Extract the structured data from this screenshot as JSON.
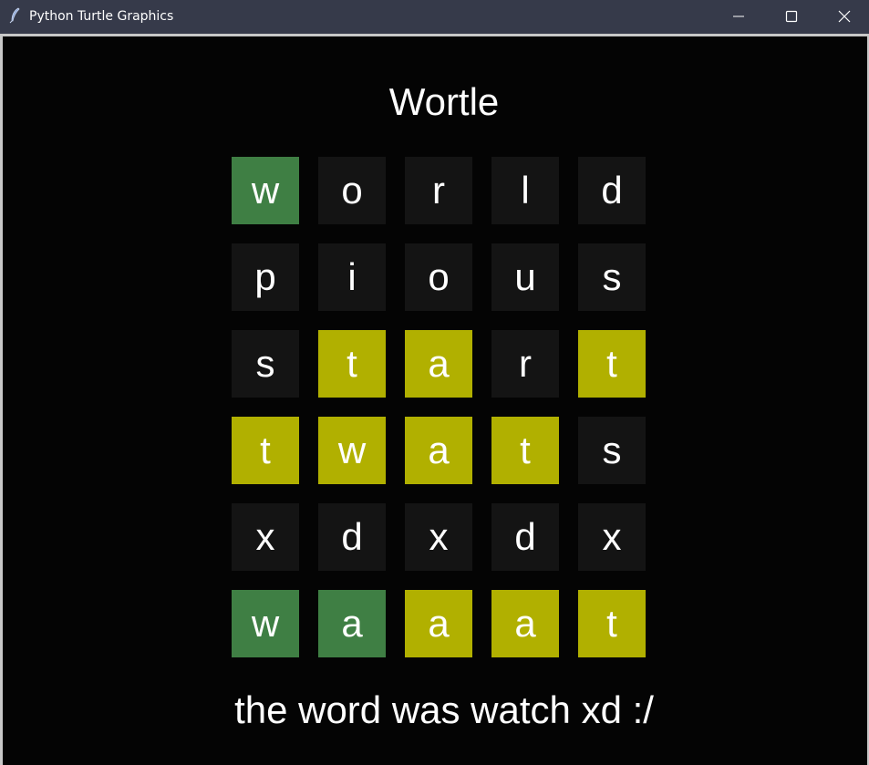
{
  "window": {
    "title": "Python Turtle Graphics",
    "icon": "feather-icon",
    "controls": [
      "minimize-icon",
      "maximize-icon",
      "close-icon"
    ]
  },
  "colors": {
    "background": "#040404",
    "empty": "#141414",
    "correct": "#3f7f44",
    "present": "#b1b000",
    "text": "#ffffff"
  },
  "game": {
    "title": "Wortle",
    "rows": [
      [
        {
          "letter": "w",
          "state": "correct"
        },
        {
          "letter": "o",
          "state": "absent"
        },
        {
          "letter": "r",
          "state": "absent"
        },
        {
          "letter": "l",
          "state": "absent"
        },
        {
          "letter": "d",
          "state": "absent"
        }
      ],
      [
        {
          "letter": "p",
          "state": "absent"
        },
        {
          "letter": "i",
          "state": "absent"
        },
        {
          "letter": "o",
          "state": "absent"
        },
        {
          "letter": "u",
          "state": "absent"
        },
        {
          "letter": "s",
          "state": "absent"
        }
      ],
      [
        {
          "letter": "s",
          "state": "absent"
        },
        {
          "letter": "t",
          "state": "present"
        },
        {
          "letter": "a",
          "state": "present"
        },
        {
          "letter": "r",
          "state": "absent"
        },
        {
          "letter": "t",
          "state": "present"
        }
      ],
      [
        {
          "letter": "t",
          "state": "present"
        },
        {
          "letter": "w",
          "state": "present"
        },
        {
          "letter": "a",
          "state": "present"
        },
        {
          "letter": "t",
          "state": "present"
        },
        {
          "letter": "s",
          "state": "absent"
        }
      ],
      [
        {
          "letter": "x",
          "state": "absent"
        },
        {
          "letter": "d",
          "state": "absent"
        },
        {
          "letter": "x",
          "state": "absent"
        },
        {
          "letter": "d",
          "state": "absent"
        },
        {
          "letter": "x",
          "state": "absent"
        }
      ],
      [
        {
          "letter": "w",
          "state": "correct"
        },
        {
          "letter": "a",
          "state": "correct"
        },
        {
          "letter": "a",
          "state": "present"
        },
        {
          "letter": "a",
          "state": "present"
        },
        {
          "letter": "t",
          "state": "present"
        }
      ]
    ],
    "message": "the word was watch xd :/"
  }
}
